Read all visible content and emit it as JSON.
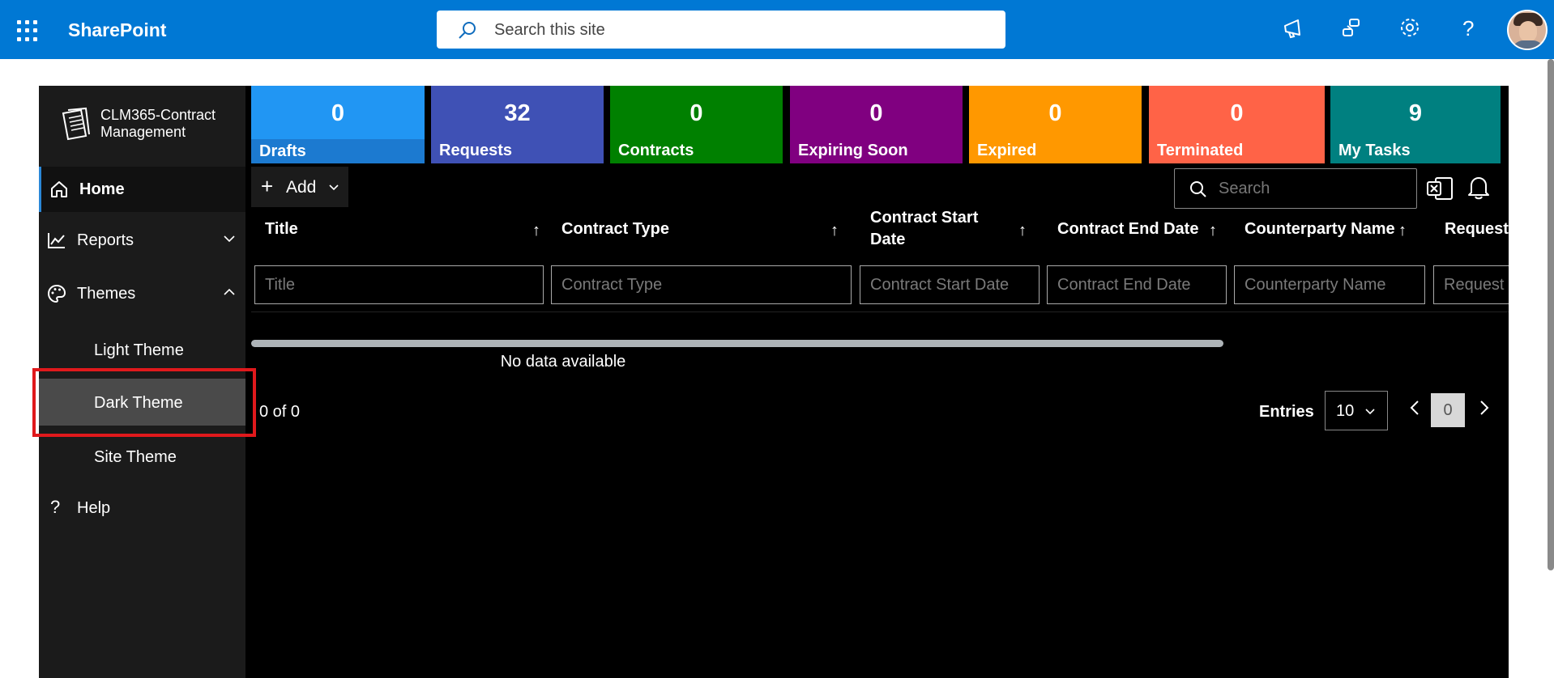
{
  "suite_bar": {
    "brand": "SharePoint",
    "search_placeholder": "Search this site",
    "icons": [
      "waffle-icon",
      "megaphone-icon",
      "share-icon",
      "settings-gear-icon",
      "help-question-icon",
      "avatar"
    ]
  },
  "app": {
    "logo_line1": "CLM365-Contract",
    "logo_line2": "Management"
  },
  "sidebar": {
    "home": "Home",
    "reports": "Reports",
    "themes": "Themes",
    "light_theme": "Light Theme",
    "dark_theme": "Dark Theme",
    "site_theme": "Site Theme",
    "help": "Help"
  },
  "tiles": [
    {
      "count": "0",
      "label": "Drafts",
      "color": "#2196f3"
    },
    {
      "count": "32",
      "label": "Requests",
      "color": "#3f51b5"
    },
    {
      "count": "0",
      "label": "Contracts",
      "color": "#008000"
    },
    {
      "count": "0",
      "label": "Expiring Soon",
      "color": "#800080"
    },
    {
      "count": "0",
      "label": "Expired",
      "color": "#ff9800"
    },
    {
      "count": "0",
      "label": "Terminated",
      "color": "#ff6347"
    },
    {
      "count": "9",
      "label": "My Tasks",
      "color": "#008080"
    }
  ],
  "toolbar": {
    "add_label": "Add",
    "search_placeholder": "Search"
  },
  "grid": {
    "columns": [
      "Title",
      "Contract Type",
      "Contract Start Date",
      "Contract End Date",
      "Counterparty Name",
      "Request"
    ],
    "filter_placeholders": [
      "Title",
      "Contract Type",
      "Contract Start Date",
      "Contract End Date",
      "Counterparty Name",
      "Request"
    ],
    "sort_arrow": "↑",
    "empty_text": "No data available"
  },
  "pager": {
    "count_text": "0 of 0",
    "entries_label": "Entries",
    "entries_value": "10",
    "current_page": "0"
  },
  "colors": {
    "suite_bar": "#0078d4",
    "app_bg": "#000000",
    "sidebar_bg": "#1b1b1b",
    "active_item": "#4a4a4a",
    "highlight": "#e0191c"
  }
}
